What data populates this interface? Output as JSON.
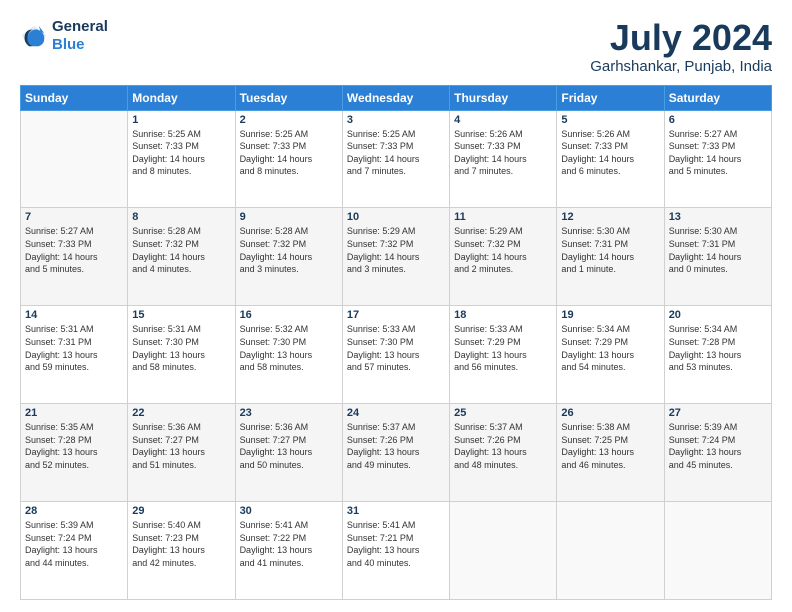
{
  "header": {
    "logo_line1": "General",
    "logo_line2": "Blue",
    "title": "July 2024",
    "subtitle": "Garhshankar, Punjab, India"
  },
  "weekdays": [
    "Sunday",
    "Monday",
    "Tuesday",
    "Wednesday",
    "Thursday",
    "Friday",
    "Saturday"
  ],
  "weeks": [
    [
      {
        "day": "",
        "info": ""
      },
      {
        "day": "1",
        "info": "Sunrise: 5:25 AM\nSunset: 7:33 PM\nDaylight: 14 hours\nand 8 minutes."
      },
      {
        "day": "2",
        "info": "Sunrise: 5:25 AM\nSunset: 7:33 PM\nDaylight: 14 hours\nand 8 minutes."
      },
      {
        "day": "3",
        "info": "Sunrise: 5:25 AM\nSunset: 7:33 PM\nDaylight: 14 hours\nand 7 minutes."
      },
      {
        "day": "4",
        "info": "Sunrise: 5:26 AM\nSunset: 7:33 PM\nDaylight: 14 hours\nand 7 minutes."
      },
      {
        "day": "5",
        "info": "Sunrise: 5:26 AM\nSunset: 7:33 PM\nDaylight: 14 hours\nand 6 minutes."
      },
      {
        "day": "6",
        "info": "Sunrise: 5:27 AM\nSunset: 7:33 PM\nDaylight: 14 hours\nand 5 minutes."
      }
    ],
    [
      {
        "day": "7",
        "info": "Sunrise: 5:27 AM\nSunset: 7:33 PM\nDaylight: 14 hours\nand 5 minutes."
      },
      {
        "day": "8",
        "info": "Sunrise: 5:28 AM\nSunset: 7:32 PM\nDaylight: 14 hours\nand 4 minutes."
      },
      {
        "day": "9",
        "info": "Sunrise: 5:28 AM\nSunset: 7:32 PM\nDaylight: 14 hours\nand 3 minutes."
      },
      {
        "day": "10",
        "info": "Sunrise: 5:29 AM\nSunset: 7:32 PM\nDaylight: 14 hours\nand 3 minutes."
      },
      {
        "day": "11",
        "info": "Sunrise: 5:29 AM\nSunset: 7:32 PM\nDaylight: 14 hours\nand 2 minutes."
      },
      {
        "day": "12",
        "info": "Sunrise: 5:30 AM\nSunset: 7:31 PM\nDaylight: 14 hours\nand 1 minute."
      },
      {
        "day": "13",
        "info": "Sunrise: 5:30 AM\nSunset: 7:31 PM\nDaylight: 14 hours\nand 0 minutes."
      }
    ],
    [
      {
        "day": "14",
        "info": "Sunrise: 5:31 AM\nSunset: 7:31 PM\nDaylight: 13 hours\nand 59 minutes."
      },
      {
        "day": "15",
        "info": "Sunrise: 5:31 AM\nSunset: 7:30 PM\nDaylight: 13 hours\nand 58 minutes."
      },
      {
        "day": "16",
        "info": "Sunrise: 5:32 AM\nSunset: 7:30 PM\nDaylight: 13 hours\nand 58 minutes."
      },
      {
        "day": "17",
        "info": "Sunrise: 5:33 AM\nSunset: 7:30 PM\nDaylight: 13 hours\nand 57 minutes."
      },
      {
        "day": "18",
        "info": "Sunrise: 5:33 AM\nSunset: 7:29 PM\nDaylight: 13 hours\nand 56 minutes."
      },
      {
        "day": "19",
        "info": "Sunrise: 5:34 AM\nSunset: 7:29 PM\nDaylight: 13 hours\nand 54 minutes."
      },
      {
        "day": "20",
        "info": "Sunrise: 5:34 AM\nSunset: 7:28 PM\nDaylight: 13 hours\nand 53 minutes."
      }
    ],
    [
      {
        "day": "21",
        "info": "Sunrise: 5:35 AM\nSunset: 7:28 PM\nDaylight: 13 hours\nand 52 minutes."
      },
      {
        "day": "22",
        "info": "Sunrise: 5:36 AM\nSunset: 7:27 PM\nDaylight: 13 hours\nand 51 minutes."
      },
      {
        "day": "23",
        "info": "Sunrise: 5:36 AM\nSunset: 7:27 PM\nDaylight: 13 hours\nand 50 minutes."
      },
      {
        "day": "24",
        "info": "Sunrise: 5:37 AM\nSunset: 7:26 PM\nDaylight: 13 hours\nand 49 minutes."
      },
      {
        "day": "25",
        "info": "Sunrise: 5:37 AM\nSunset: 7:26 PM\nDaylight: 13 hours\nand 48 minutes."
      },
      {
        "day": "26",
        "info": "Sunrise: 5:38 AM\nSunset: 7:25 PM\nDaylight: 13 hours\nand 46 minutes."
      },
      {
        "day": "27",
        "info": "Sunrise: 5:39 AM\nSunset: 7:24 PM\nDaylight: 13 hours\nand 45 minutes."
      }
    ],
    [
      {
        "day": "28",
        "info": "Sunrise: 5:39 AM\nSunset: 7:24 PM\nDaylight: 13 hours\nand 44 minutes."
      },
      {
        "day": "29",
        "info": "Sunrise: 5:40 AM\nSunset: 7:23 PM\nDaylight: 13 hours\nand 42 minutes."
      },
      {
        "day": "30",
        "info": "Sunrise: 5:41 AM\nSunset: 7:22 PM\nDaylight: 13 hours\nand 41 minutes."
      },
      {
        "day": "31",
        "info": "Sunrise: 5:41 AM\nSunset: 7:21 PM\nDaylight: 13 hours\nand 40 minutes."
      },
      {
        "day": "",
        "info": ""
      },
      {
        "day": "",
        "info": ""
      },
      {
        "day": "",
        "info": ""
      }
    ]
  ]
}
